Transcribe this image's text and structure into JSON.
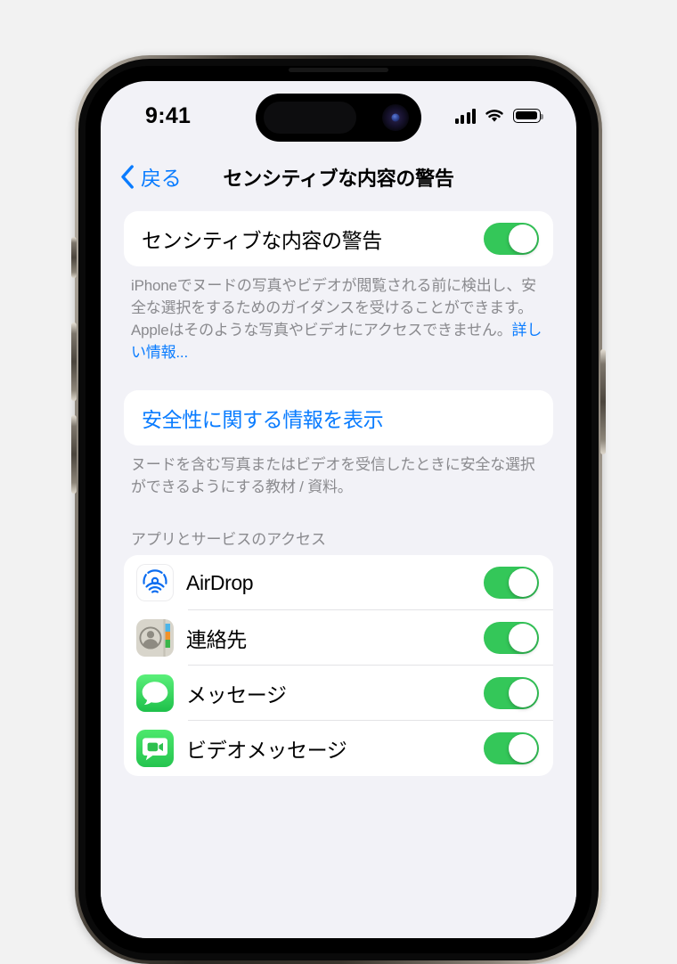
{
  "status_bar": {
    "time": "9:41",
    "cellular_icon": "signal-bars-icon",
    "wifi_icon": "wifi-icon",
    "battery_icon": "battery-full-icon"
  },
  "nav": {
    "back_label": "戻る",
    "back_icon": "chevron-left-icon",
    "title": "センシティブな内容の警告"
  },
  "sections": {
    "warning": {
      "row_label": "センシティブな内容の警告",
      "toggle_state": "on",
      "footnote_text": "iPhoneでヌードの写真やビデオが閲覧される前に検出し、安全な選択をするためのガイダンスを受けることができます。Appleはそのような写真やビデオにアクセスできません。",
      "footnote_link": "詳しい情報..."
    },
    "safety_info": {
      "row_label": "安全性に関する情報を表示",
      "footnote_text": "ヌードを含む写真またはビデオを受信したときに安全な選択ができるようにする教材 / 資料。"
    },
    "apps": {
      "header": "アプリとサービスのアクセス",
      "rows": [
        {
          "label": "AirDrop",
          "icon": "airdrop-icon",
          "toggle_state": "on"
        },
        {
          "label": "連絡先",
          "icon": "contacts-icon",
          "toggle_state": "on"
        },
        {
          "label": "メッセージ",
          "icon": "messages-icon",
          "toggle_state": "on"
        },
        {
          "label": "ビデオメッセージ",
          "icon": "video-messages-icon",
          "toggle_state": "on"
        }
      ]
    }
  },
  "colors": {
    "accent_blue": "#0a7cff",
    "toggle_green": "#34c759",
    "screen_background": "#f2f2f7",
    "card_background": "#ffffff",
    "secondary_text": "#8a8a8e"
  }
}
